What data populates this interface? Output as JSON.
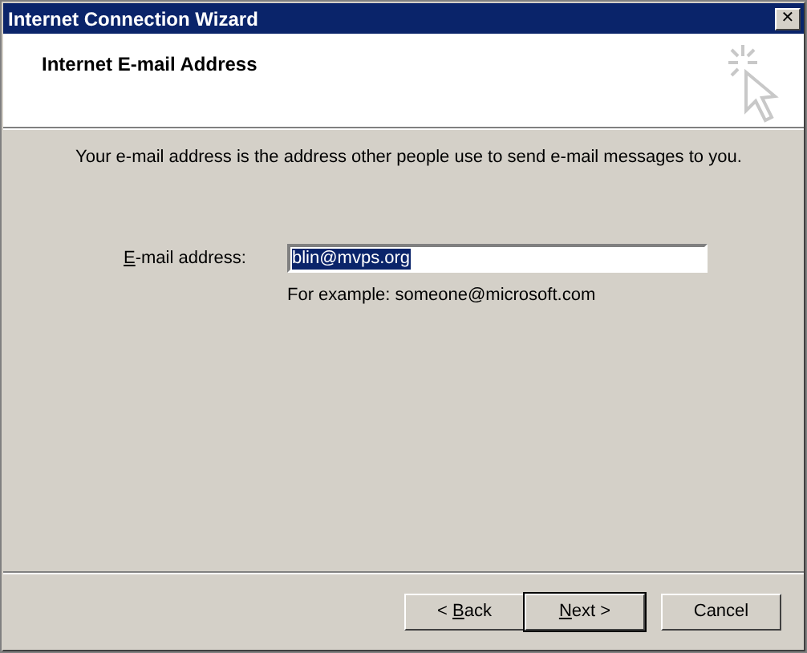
{
  "window": {
    "title": "Internet Connection Wizard",
    "close": "✕"
  },
  "header": {
    "title": "Internet E-mail Address"
  },
  "description": "Your e-mail address is the address other people use to send e-mail messages to you.",
  "email": {
    "label_key": "E",
    "label_rest": "-mail address:",
    "value": "blin@mvps.org",
    "selected": true,
    "hint": "For example: someone@microsoft.com"
  },
  "buttons": [
    {
      "kind": "back",
      "prefix": "< ",
      "key": "B",
      "rest": "ack",
      "default": false
    },
    {
      "kind": "next",
      "key": "N",
      "rest": "ext",
      "suffix": " >",
      "default": true
    },
    {
      "kind": "cancel",
      "rest": "Cancel",
      "default": false
    }
  ]
}
